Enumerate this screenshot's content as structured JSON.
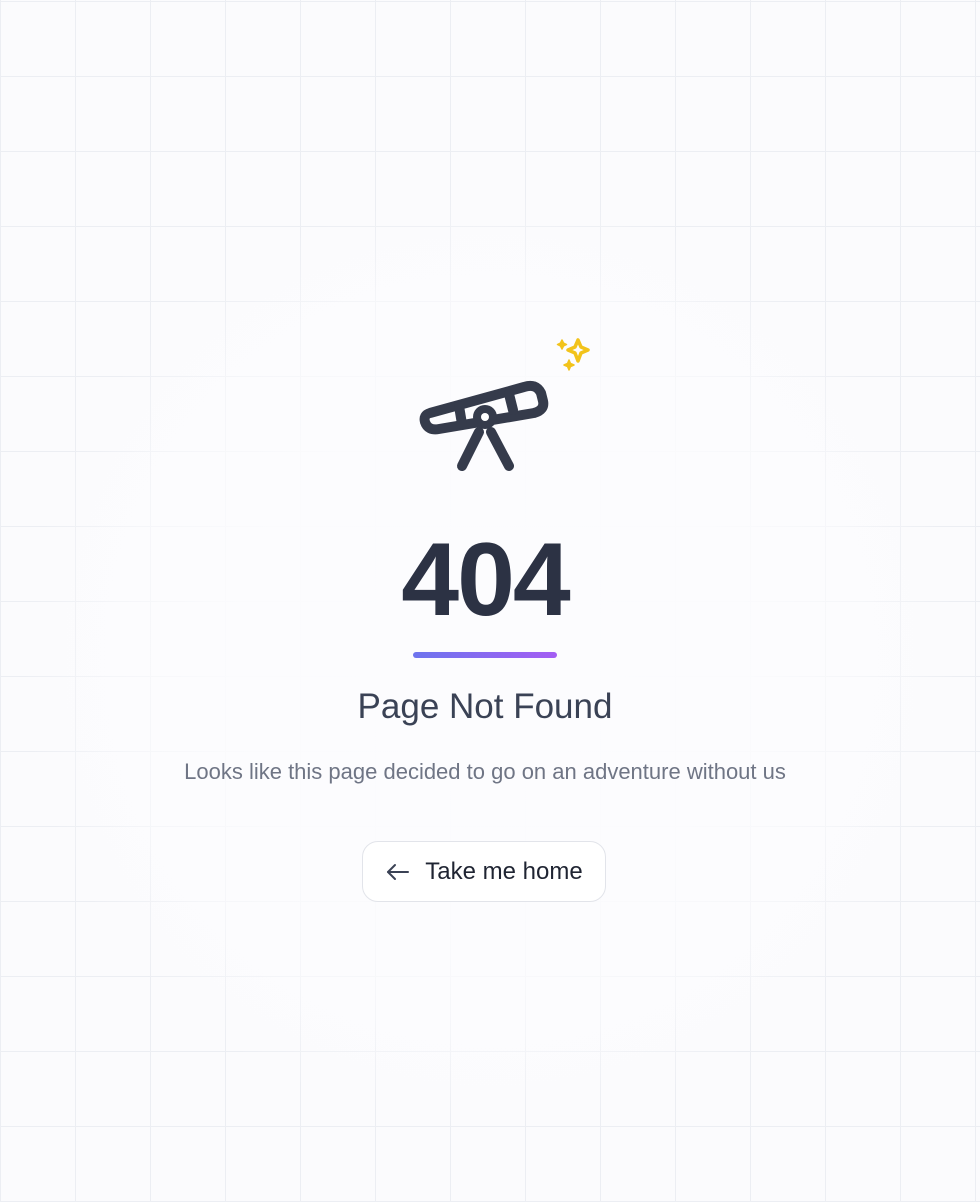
{
  "error": {
    "code": "404",
    "title": "Page Not Found",
    "message": "Looks like this page decided to go on an adventure without us"
  },
  "action": {
    "home_label": "Take me home",
    "icon": "arrow-left-icon"
  },
  "illustration": {
    "icon": "telescope-icon",
    "sparkle_icon": "sparkles-icon"
  },
  "colors": {
    "text_primary": "#2c3244",
    "accent_gradient_start": "#6d74ee",
    "accent_gradient_end": "#a45df3",
    "sparkle": "#f2c31b"
  }
}
